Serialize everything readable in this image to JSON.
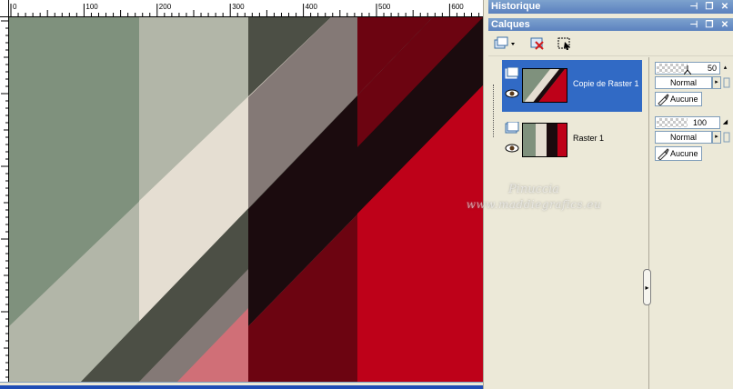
{
  "ruler": {
    "labels": [
      "0",
      "100",
      "200",
      "300",
      "400",
      "500",
      "600"
    ]
  },
  "panels": {
    "history_title": "Historique",
    "layers_title": "Calques"
  },
  "layers": [
    {
      "name": "Copie de Raster 1",
      "selected": true,
      "opacity": "50",
      "blend_mode": "Normal",
      "mask": "Aucune"
    },
    {
      "name": "Raster 1",
      "selected": false,
      "opacity": "100",
      "blend_mode": "Normal",
      "mask": "Aucune"
    }
  ],
  "watermark": {
    "line1": "Pinuccia",
    "line2": "www.maddiegrafics.eu"
  },
  "colors": {
    "sage": "#7F917D",
    "light_sage": "#B2B6A8",
    "cream": "#E5DED2",
    "dark_olive": "#4C4F45",
    "taupe": "#847976",
    "near_black": "#1B0B0E",
    "salmon": "#D06F77",
    "maroon": "#6C0411",
    "red": "#BE0119",
    "accent_blue": "#316AC5"
  },
  "icons": {
    "new_layer": "new-layer-icon",
    "delete_layer": "delete-layer-icon",
    "selection_mode": "selection-icon"
  }
}
